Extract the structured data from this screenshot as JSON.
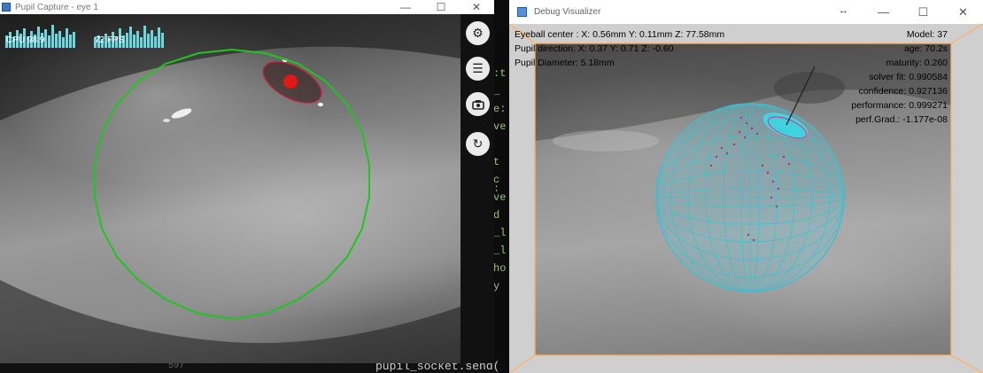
{
  "terminal": {
    "fragments": [
      ":t",
      "_",
      "e:",
      "ve",
      "t",
      "c",
      ":",
      "ve",
      "d",
      "_l",
      "_l",
      "ho",
      "y"
    ],
    "bottom_number": "597",
    "bottom_code": "pupil_socket.send("
  },
  "capture_window": {
    "title": "Pupil Capture - eye 1",
    "controls": {
      "minimize": "—",
      "maximize": "☐",
      "close": "✕"
    },
    "cpu_label": "CPU 98.9",
    "fps_label": "72 FPS",
    "sidebar_icons": [
      "gear-icon",
      "list-icon",
      "camera-icon",
      "refresh-icon"
    ],
    "colors": {
      "fit_circle": "#22c322",
      "pupil": "#e01818",
      "hud": "#7fcfd4"
    }
  },
  "visualizer_window": {
    "title": "Debug Visualizer",
    "controls": {
      "minimize": "—",
      "maximize": "☐",
      "close": "✕"
    },
    "left_info": [
      "Eyeball center : X: 0.56mm Y: 0.11mm Z: 77.58mm",
      "Pupil direction:  X: 0.37 Y: 0.71 Z: -0.60",
      "Pupil Diameter: 5.18mm"
    ],
    "right_info": [
      "Model: 37",
      "age: 70.2s",
      "maturity: 0.260",
      "solver fit: 0.990584",
      "confidence: 0.927136",
      "performance: 0.999271",
      "perf.Grad.: -1.177e-08"
    ],
    "colors": {
      "sphere": "#3bbfd0",
      "frame": "#ffb266",
      "dots": "#b0306a"
    }
  }
}
